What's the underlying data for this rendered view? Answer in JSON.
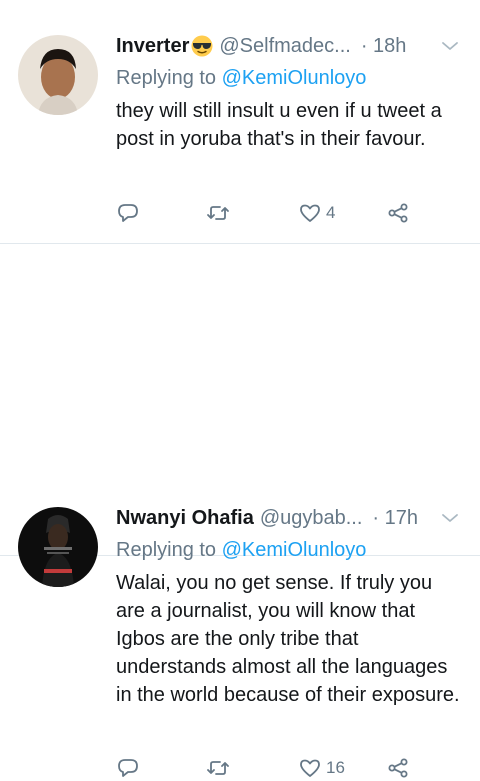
{
  "tweets": [
    {
      "display_name": "Inverter",
      "emoji": "sunglasses-emoji",
      "handle": "@Selfmadec...",
      "time": "· 18h",
      "replying_prefix": "Replying to",
      "replying_to": "@KemiOlunloyo",
      "text": "they will still insult u even if u tweet a post in yoruba that's in their favour.",
      "reply_count": "",
      "retweet_count": "",
      "like_count": "4"
    },
    {
      "display_name": "Nwanyi Ohafia",
      "handle": "@ugybab...",
      "time": "· 17h",
      "replying_prefix": "Replying to",
      "replying_to": "@KemiOlunloyo",
      "text": "Walai, you no get sense. If truly you are a journalist, you will know that Igbos are the only tribe that understands almost all the languages in the world because of their exposure.",
      "reply_count": "",
      "retweet_count": "",
      "like_count": "16"
    }
  ],
  "colors": {
    "link": "#1da1f2",
    "muted": "#657786",
    "text": "#14171a",
    "divider": "#e1e8ed"
  }
}
